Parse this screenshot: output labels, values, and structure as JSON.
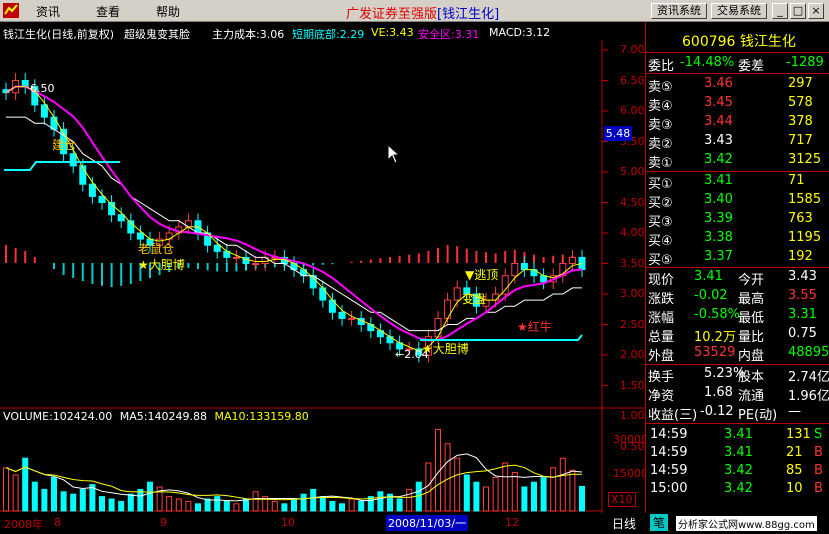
{
  "menu": {
    "items": [
      "资讯",
      "查看",
      "帮助"
    ],
    "app_title": "广发证券至强版",
    "app_stock": "[钱江生化]",
    "btn_info": "资讯系统",
    "btn_trade": "交易系统",
    "btn_min": "_",
    "btn_max": "□",
    "btn_close": "×"
  },
  "chart_header": {
    "title": "钱江生化(日线,前复权)",
    "indicator": "超级鬼变其脸",
    "main_cost": "主力成本:3.06",
    "short_bottom": "短期底部:2.29",
    "ve": "VE:3.43",
    "safe_zone": "安全区:3.31",
    "macd": "MACD:3.12"
  },
  "price_axis": [
    "7.00",
    "6.50",
    "6.00",
    "5.50",
    "5.00",
    "4.50",
    "4.00",
    "3.50",
    "3.00",
    "2.50",
    "2.00",
    "1.50",
    "1.00",
    "0.50"
  ],
  "current_price_flag": "5.48",
  "volume_header": {
    "volume": "VOLUME:102424.00",
    "ma5": "MA5:140249.88",
    "ma10": "MA10:133159.80"
  },
  "volume_axis": [
    "30000",
    "15000",
    "X10"
  ],
  "date_axis": {
    "labels": [
      "2008年",
      "8",
      "9",
      "10",
      "12"
    ],
    "cursor_date": "2008/11/03/一"
  },
  "annotations": {
    "high": "6.50",
    "low": "←2.04",
    "cang": "建仓",
    "dadan1": "大胆博",
    "dadan2": "大胆博",
    "taoding": "逃顶",
    "hongniu": "★红牛",
    "laoshu": "老鼠仓",
    "bianpan": "变盘"
  },
  "quote": {
    "code_name": "600796 钱江生化",
    "weibi_label": "委比",
    "weibi": "-14.48%",
    "weicha_label": "委差",
    "weicha": "-1289",
    "asks": [
      {
        "label": "卖⑤",
        "price": "3.46",
        "vol": "297"
      },
      {
        "label": "卖④",
        "price": "3.45",
        "vol": "578"
      },
      {
        "label": "卖③",
        "price": "3.44",
        "vol": "378"
      },
      {
        "label": "卖②",
        "price": "3.43",
        "vol": "717"
      },
      {
        "label": "卖①",
        "price": "3.42",
        "vol": "3125"
      }
    ],
    "bids": [
      {
        "label": "买①",
        "price": "3.41",
        "vol": "71"
      },
      {
        "label": "买②",
        "price": "3.40",
        "vol": "1585"
      },
      {
        "label": "买③",
        "price": "3.39",
        "vol": "763"
      },
      {
        "label": "买④",
        "price": "3.38",
        "vol": "1195"
      },
      {
        "label": "买⑤",
        "price": "3.37",
        "vol": "192"
      }
    ],
    "stats": [
      {
        "l1": "现价",
        "v1": "3.41",
        "l2": "今开",
        "v2": "3.43"
      },
      {
        "l1": "涨跌",
        "v1": "-0.02",
        "l2": "最高",
        "v2": "3.55"
      },
      {
        "l1": "涨幅",
        "v1": "-0.58%",
        "l2": "最低",
        "v2": "3.31"
      },
      {
        "l1": "总量",
        "v1": "10.2万",
        "l2": "量比",
        "v2": "0.75"
      },
      {
        "l1": "外盘",
        "v1": "53529",
        "l2": "内盘",
        "v2": "48895"
      }
    ],
    "fin": [
      {
        "l1": "换手",
        "v1": "5.23%",
        "l2": "股本",
        "v2": "2.74亿"
      },
      {
        "l1": "净资",
        "v1": "1.68",
        "l2": "流通",
        "v2": "1.96亿"
      },
      {
        "l1": "收益(三)",
        "v1": "-0.12",
        "l2": "PE(动)",
        "v2": "—"
      }
    ],
    "ticks": [
      {
        "time": "14:59",
        "price": "3.41",
        "vol": "131",
        "side": "S"
      },
      {
        "time": "14:59",
        "price": "3.41",
        "vol": "21",
        "side": "B"
      },
      {
        "time": "14:59",
        "price": "3.42",
        "vol": "85",
        "side": "B"
      },
      {
        "time": "15:00",
        "price": "3.42",
        "vol": "10",
        "side": "B"
      }
    ],
    "tab_daily": "日线",
    "tab_bi": "笔",
    "watermark": "分析家公式网www.88gg.com"
  },
  "chart_data": {
    "type": "line",
    "ylim": [
      0.5,
      7.0
    ],
    "close": [
      6.3,
      6.5,
      6.4,
      6.1,
      5.9,
      5.7,
      5.3,
      5.1,
      4.8,
      4.6,
      4.5,
      4.3,
      4.2,
      4.0,
      3.9,
      3.8,
      3.9,
      4.0,
      4.1,
      4.2,
      4.0,
      3.8,
      3.7,
      3.6,
      3.6,
      3.5,
      3.5,
      3.6,
      3.6,
      3.5,
      3.4,
      3.3,
      3.1,
      2.9,
      2.7,
      2.6,
      2.6,
      2.5,
      2.4,
      2.3,
      2.2,
      2.1,
      2.1,
      2.0,
      2.3,
      2.6,
      2.9,
      3.1,
      3.0,
      2.8,
      2.9,
      3.0,
      3.3,
      3.5,
      3.4,
      3.3,
      3.2,
      3.3,
      3.5,
      3.6,
      3.4
    ],
    "ma_slow": [
      5.9,
      5.9,
      5.9,
      5.8,
      5.8,
      5.7,
      5.6,
      5.5,
      5.3,
      5.2,
      5.1,
      4.9,
      4.8,
      4.6,
      4.5,
      4.4,
      4.3,
      4.2,
      4.2,
      4.1,
      4.0,
      4.0,
      3.9,
      3.8,
      3.8,
      3.7,
      3.6,
      3.6,
      3.5,
      3.5,
      3.4,
      3.3,
      3.3,
      3.2,
      3.1,
      3.0,
      2.9,
      2.8,
      2.7,
      2.7,
      2.6,
      2.5,
      2.4,
      2.4,
      2.4,
      2.4,
      2.5,
      2.5,
      2.6,
      2.6,
      2.7,
      2.7,
      2.8,
      2.8,
      2.9,
      2.9,
      2.9,
      3.0,
      3.0,
      3.1,
      3.1
    ],
    "volume": [
      18000,
      15000,
      22000,
      12000,
      9000,
      14000,
      8000,
      7000,
      9000,
      11000,
      6000,
      5000,
      4000,
      7000,
      9000,
      12000,
      10000,
      6000,
      5000,
      4000,
      3000,
      5000,
      6000,
      4000,
      3000,
      5000,
      8000,
      6000,
      4000,
      3000,
      5000,
      7000,
      9000,
      6000,
      4000,
      3000,
      5000,
      4000,
      6000,
      8000,
      7000,
      5000,
      9000,
      12000,
      20000,
      34000,
      28000,
      22000,
      15000,
      12000,
      10000,
      14000,
      20000,
      16000,
      10000,
      12000,
      14000,
      18000,
      22000,
      17000,
      10242
    ],
    "macd": [
      0.3,
      0.25,
      0.2,
      0.1,
      0.0,
      -0.1,
      -0.2,
      -0.25,
      -0.3,
      -0.35,
      -0.38,
      -0.4,
      -0.38,
      -0.35,
      -0.3,
      -0.25,
      -0.2,
      -0.15,
      -0.1,
      -0.08,
      -0.1,
      -0.12,
      -0.14,
      -0.15,
      -0.14,
      -0.12,
      -0.1,
      -0.08,
      -0.07,
      -0.06,
      -0.05,
      -0.05,
      -0.04,
      -0.03,
      -0.02,
      0.0,
      0.02,
      0.04,
      0.06,
      0.08,
      0.1,
      0.12,
      0.14,
      0.16,
      0.2,
      0.25,
      0.3,
      0.28,
      0.24,
      0.2,
      0.18,
      0.16,
      0.2,
      0.22,
      0.18,
      0.14,
      0.1,
      0.12,
      0.14,
      0.12,
      0.1
    ]
  }
}
